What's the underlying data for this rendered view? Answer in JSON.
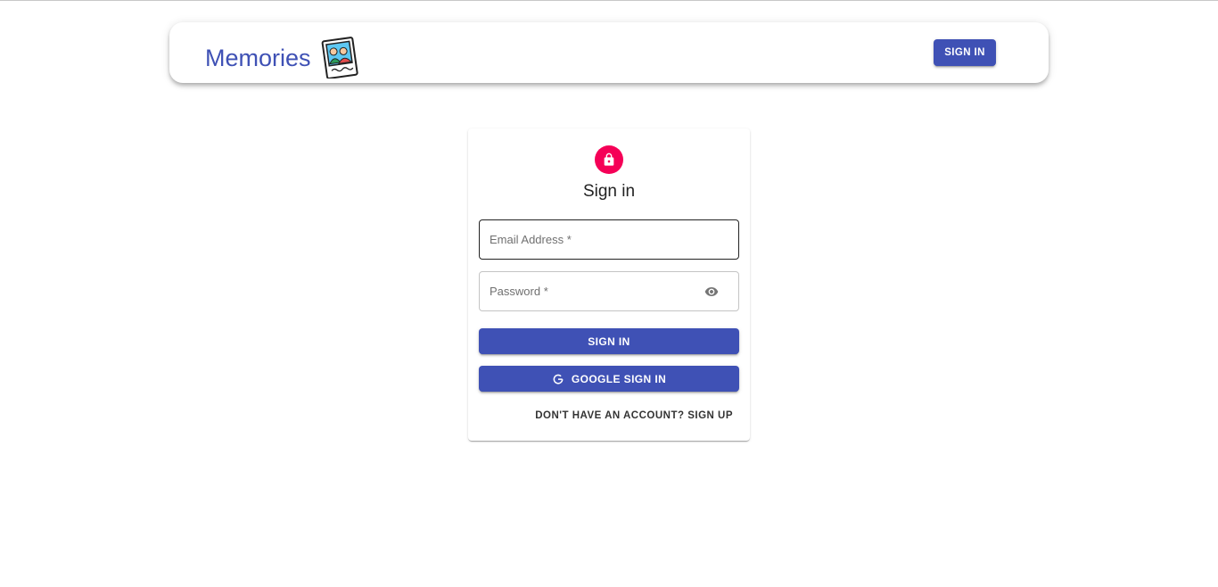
{
  "appbar": {
    "title": "Memories",
    "logo_icon": "photo-album-icon",
    "signin_label": "SIGN IN"
  },
  "auth": {
    "lock_icon": "lock-icon",
    "title": "Sign in",
    "email_label": "Email Address *",
    "password_label": "Password *",
    "visibility_icon": "eye-icon",
    "signin_label": "SIGN IN",
    "google_icon": "google-icon",
    "google_label": "GOOGLE SIGN IN",
    "switch_label": "DON'T HAVE AN ACCOUNT? SIGN UP"
  },
  "colors": {
    "primary": "#3f51b5",
    "secondary": "#f50057",
    "background": "#ffffff"
  }
}
